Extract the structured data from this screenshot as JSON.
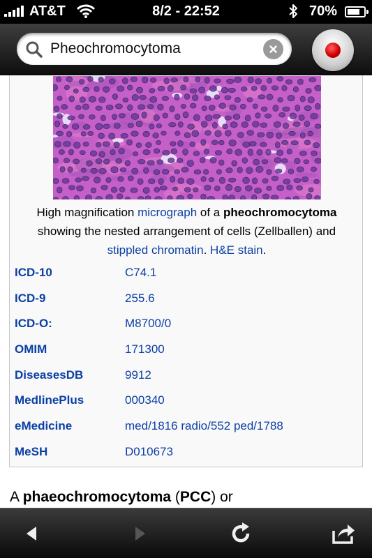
{
  "status_bar": {
    "carrier": "AT&T",
    "time": "8/2 - 22:52",
    "battery_percent": "70%",
    "battery_level": 0.7,
    "icons": [
      "signal-bars-icon",
      "wifi-icon",
      "bluetooth-icon",
      "battery-icon"
    ]
  },
  "search": {
    "query": "Pheochromocytoma",
    "icons": [
      "search-icon",
      "clear-icon",
      "record-icon"
    ]
  },
  "infobox": {
    "caption": {
      "t1": "High magnification ",
      "link1": "micrograph",
      "t2": " of a ",
      "bold": "pheochromocytoma",
      "t3": "showing the nested arrangement of cells (Zellballen) and",
      "link2": "stippled chromatin",
      "t4": ". ",
      "link3": "H&E stain",
      "t5": "."
    },
    "codes": [
      {
        "label": "ICD-10",
        "value": "C74.1"
      },
      {
        "label": "ICD-9",
        "value": "255.6"
      },
      {
        "label": "ICD-O:",
        "value": "M8700/0"
      },
      {
        "label": "OMIM",
        "value": "171300"
      },
      {
        "label": "DiseasesDB",
        "value": "9912"
      },
      {
        "label": "MedlinePlus",
        "value": "000340"
      },
      {
        "label": "eMedicine",
        "value": "med/1816 radio/552 ped/1788"
      },
      {
        "label": "MeSH",
        "value": "D010673"
      }
    ]
  },
  "article": {
    "t1": "A ",
    "bold1": "phaeochromocytoma",
    "t2": " (",
    "bold2": "PCC",
    "t3": ") or"
  },
  "toolbar": {
    "icons": [
      "back-arrow-icon",
      "forward-arrow-icon",
      "reload-icon",
      "share-icon"
    ]
  },
  "colors": {
    "link": "#0b3fa5",
    "stain": "#c45fc8",
    "record": "#d40000"
  }
}
